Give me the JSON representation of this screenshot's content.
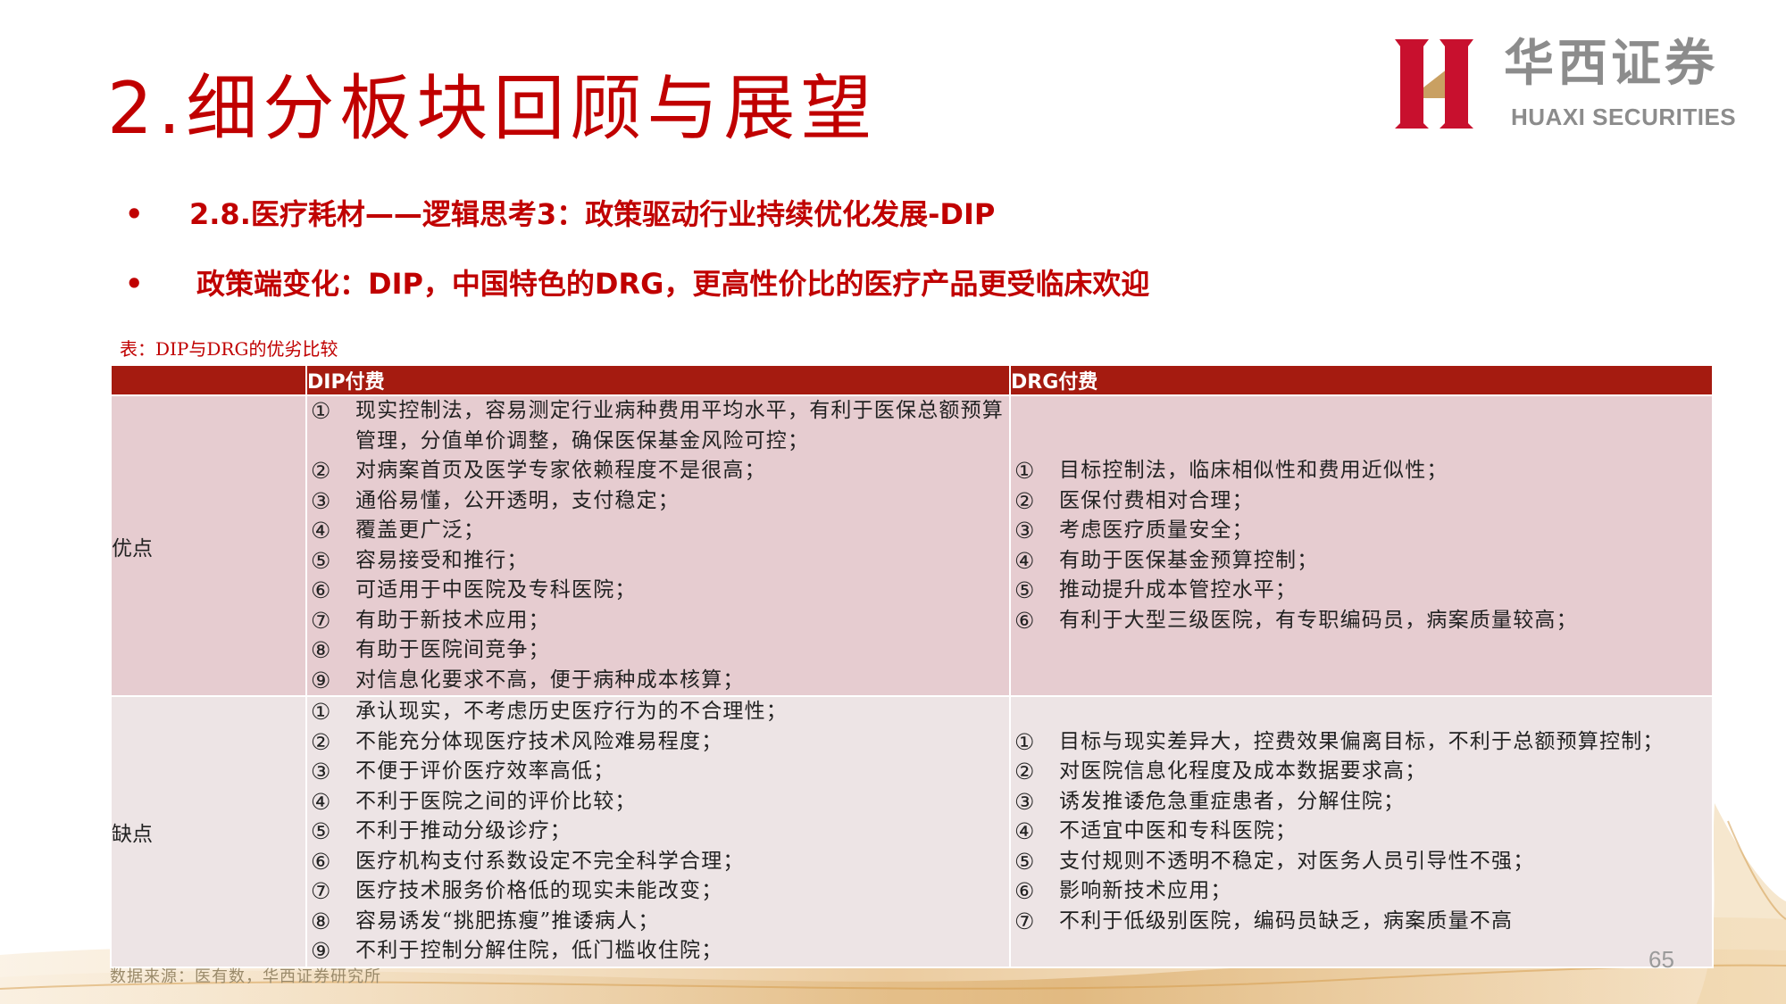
{
  "title": "2.细分板块回顾与展望",
  "logo": {
    "name_cn": "华西证券",
    "name_en": "HUAXI SECURITIES"
  },
  "bullets": [
    {
      "dot": "•",
      "text": "2.8.医疗耗材——逻辑思考3：政策驱动行业持续优化发展-DIP"
    },
    {
      "dot": "•",
      "text": "政策端变化：DIP，中国特色的DRG，更高性价比的医疗产品更受临床欢迎"
    }
  ],
  "table": {
    "caption": "表：DIP与DRG的优劣比较",
    "headers": [
      "",
      "DIP付费",
      "DRG付费"
    ],
    "rows": [
      {
        "label": "优点",
        "dip": [
          {
            "num": "①",
            "text": "现实控制法，容易测定行业病种费用平均水平，有利于医保总额预算管理，分值单价调整，确保医保基金风险可控；"
          },
          {
            "num": "②",
            "text": "对病案首页及医学专家依赖程度不是很高；"
          },
          {
            "num": "③",
            "text": "通俗易懂，公开透明，支付稳定；"
          },
          {
            "num": "④",
            "text": "覆盖更广泛；"
          },
          {
            "num": "⑤",
            "text": "容易接受和推行；"
          },
          {
            "num": "⑥",
            "text": "可适用于中医院及专科医院；"
          },
          {
            "num": "⑦",
            "text": "有助于新技术应用；"
          },
          {
            "num": "⑧",
            "text": "有助于医院间竞争；"
          },
          {
            "num": "⑨",
            "text": "对信息化要求不高，便于病种成本核算；"
          }
        ],
        "drg": [
          {
            "num": "①",
            "text": "目标控制法，临床相似性和费用近似性；"
          },
          {
            "num": "②",
            "text": "医保付费相对合理；"
          },
          {
            "num": "③",
            "text": "考虑医疗质量安全；"
          },
          {
            "num": "④",
            "text": "有助于医保基金预算控制；"
          },
          {
            "num": "⑤",
            "text": "推动提升成本管控水平；"
          },
          {
            "num": "⑥",
            "text": "有利于大型三级医院，有专职编码员，病案质量较高；"
          }
        ]
      },
      {
        "label": "缺点",
        "dip": [
          {
            "num": "①",
            "text": "承认现实，不考虑历史医疗行为的不合理性；"
          },
          {
            "num": "②",
            "text": "不能充分体现医疗技术风险难易程度；"
          },
          {
            "num": "③",
            "text": "不便于评价医疗效率高低；"
          },
          {
            "num": "④",
            "text": "不利于医院之间的评价比较；"
          },
          {
            "num": "⑤",
            "text": "不利于推动分级诊疗；"
          },
          {
            "num": "⑥",
            "text": "医疗机构支付系数设定不完全科学合理；"
          },
          {
            "num": "⑦",
            "text": "医疗技术服务价格低的现实未能改变；"
          },
          {
            "num": "⑧",
            "text": "容易诱发“挑肥拣瘦”推诿病人；"
          },
          {
            "num": "⑨",
            "text": "不利于控制分解住院，低门槛收住院；"
          }
        ],
        "drg": [
          {
            "num": "①",
            "text": "目标与现实差异大，控费效果偏离目标，不利于总额预算控制；"
          },
          {
            "num": "②",
            "text": "对医院信息化程度及成本数据要求高；"
          },
          {
            "num": "③",
            "text": "诱发推诿危急重症患者，分解住院；"
          },
          {
            "num": "④",
            "text": "不适宜中医和专科医院；"
          },
          {
            "num": "⑤",
            "text": "支付规则不透明不稳定，对医务人员引导性不强；"
          },
          {
            "num": "⑥",
            "text": "影响新技术应用；"
          },
          {
            "num": "⑦",
            "text": "不利于低级别医院，编码员缺乏，病案质量不高"
          }
        ]
      }
    ]
  },
  "source": "数据来源：医有数，华西证券研究所",
  "page_number": "65",
  "colors": {
    "title_red": "#c00000",
    "header_bg": "#a51b10",
    "row1_bg": "#e6ccd0",
    "row2_bg": "#ede4e5",
    "logo_red": "#c8102e",
    "logo_gold": "#c9a062",
    "logo_gray": "#8c8c8c"
  }
}
